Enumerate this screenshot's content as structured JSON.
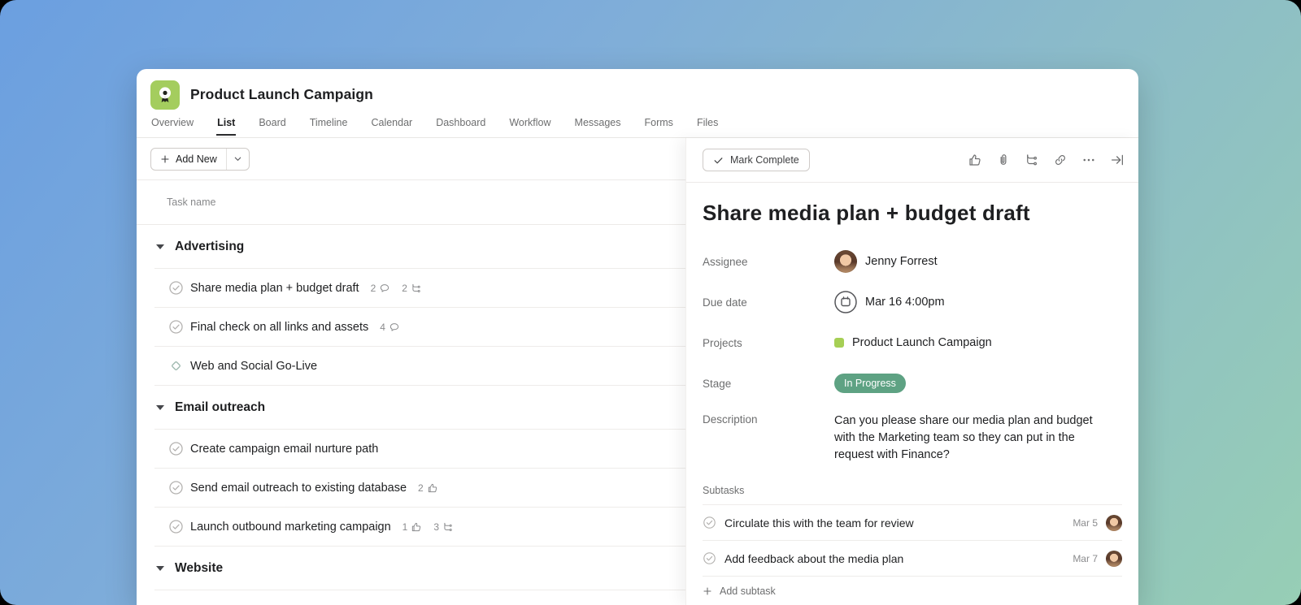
{
  "colors": {
    "accent_green": "#a4cd5e",
    "project_dot_green": "#a6cf55",
    "stage_pill_green": "#5ea283",
    "milestone_teal": "#9fbab0"
  },
  "header": {
    "title": "Product Launch Campaign",
    "app_icon": "ribbon-award-icon",
    "tabs": [
      {
        "label": "Overview",
        "active": false
      },
      {
        "label": "List",
        "active": true
      },
      {
        "label": "Board",
        "active": false
      },
      {
        "label": "Timeline",
        "active": false
      },
      {
        "label": "Calendar",
        "active": false
      },
      {
        "label": "Dashboard",
        "active": false
      },
      {
        "label": "Workflow",
        "active": false
      },
      {
        "label": "Messages",
        "active": false
      },
      {
        "label": "Forms",
        "active": false
      },
      {
        "label": "Files",
        "active": false
      }
    ]
  },
  "list_panel": {
    "add_new_label": "Add New",
    "column_header": "Task name",
    "sections": [
      {
        "name": "Advertising",
        "tasks": [
          {
            "title": "Share media plan + budget draft",
            "type": "task",
            "meta": [
              {
                "count": "2",
                "icon": "comment-icon"
              },
              {
                "count": "2",
                "icon": "subtask-icon"
              }
            ]
          },
          {
            "title": "Final check on all links and assets",
            "type": "task",
            "meta": [
              {
                "count": "4",
                "icon": "comment-icon"
              }
            ]
          },
          {
            "title": "Web and Social Go-Live",
            "type": "milestone",
            "meta": []
          }
        ]
      },
      {
        "name": "Email outreach",
        "tasks": [
          {
            "title": "Create campaign email nurture path",
            "type": "task",
            "meta": []
          },
          {
            "title": "Send email outreach to existing database",
            "type": "task",
            "meta": [
              {
                "count": "2",
                "icon": "like-icon"
              }
            ]
          },
          {
            "title": "Launch outbound marketing campaign",
            "type": "task",
            "meta": [
              {
                "count": "1",
                "icon": "like-icon"
              },
              {
                "count": "3",
                "icon": "subtask-icon"
              }
            ]
          }
        ]
      },
      {
        "name": "Website",
        "tasks": []
      }
    ]
  },
  "detail_panel": {
    "mark_complete_label": "Mark Complete",
    "header_icons": [
      "like-icon",
      "attachment-icon",
      "subtask-icon",
      "link-icon",
      "more-icon",
      "collapse-pane-icon"
    ],
    "title": "Share media plan + budget draft",
    "fields": {
      "assignee": {
        "label": "Assignee",
        "value": "Jenny Forrest"
      },
      "due_date": {
        "label": "Due date",
        "value": "Mar 16 4:00pm"
      },
      "projects": {
        "label": "Projects",
        "value": "Product Launch Campaign"
      },
      "stage": {
        "label": "Stage",
        "value": "In Progress"
      },
      "description": {
        "label": "Description",
        "value": "Can you please share our media plan and budget with the Marketing team so they can put in the request with Finance?"
      }
    },
    "subtasks": {
      "label": "Subtasks",
      "items": [
        {
          "title": "Circulate this with the team for review",
          "date": "Mar 5"
        },
        {
          "title": "Add feedback about the media plan",
          "date": "Mar 7"
        }
      ],
      "add_label": "Add subtask"
    }
  }
}
